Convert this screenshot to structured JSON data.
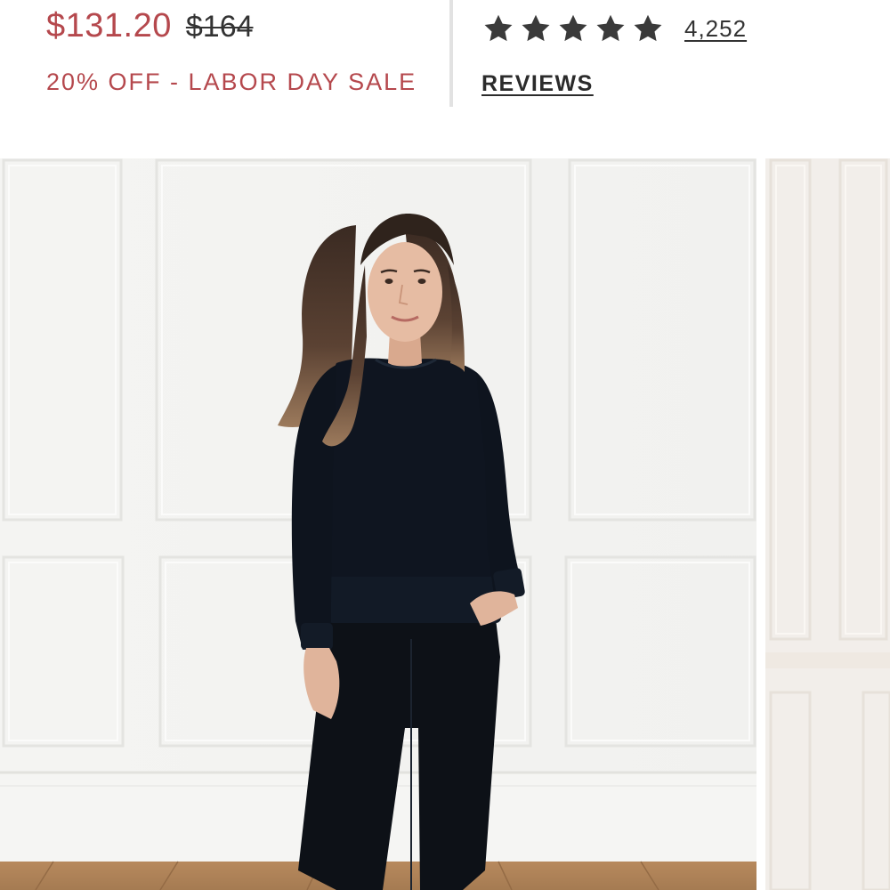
{
  "pricing": {
    "sale_price": "$131.20",
    "original_price": "$164",
    "promo_label": "20% OFF - LABOR DAY SALE",
    "sale_color": "#b5484d"
  },
  "rating": {
    "stars": 5,
    "max_stars": 5,
    "review_count": "4,252",
    "reviews_label": "REVIEWS",
    "star_color": "#3a3a3a"
  },
  "gallery": {
    "main_image": "photo-model-black-crewneck-and-joggers",
    "next_image": "photo-next-slide-partial"
  }
}
